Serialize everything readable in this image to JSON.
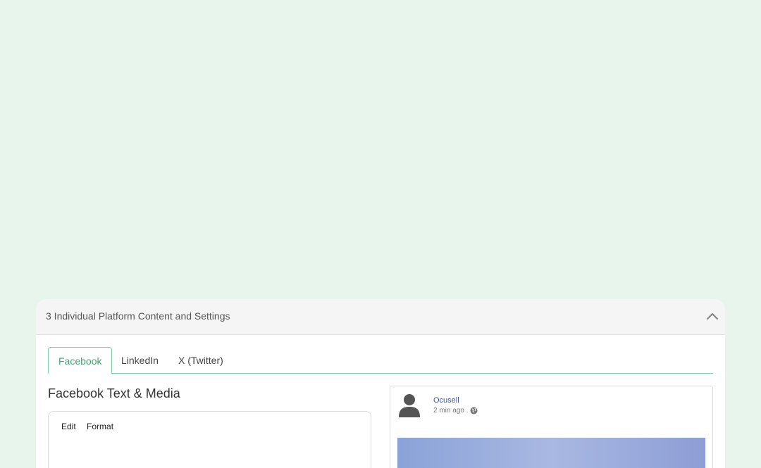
{
  "panel": {
    "title": "3 Individual Platform Content and Settings"
  },
  "tabs": [
    {
      "label": "Facebook",
      "active": true
    },
    {
      "label": "LinkedIn",
      "active": false
    },
    {
      "label": "X (Twitter)",
      "active": false
    }
  ],
  "editor_section": {
    "title": "Facebook Text & Media",
    "menu": [
      "Edit",
      "Format"
    ]
  },
  "preview": {
    "page_name": "Ocusell",
    "time": "2 min ago ."
  },
  "colors": {
    "page_bg": "#e8f5ec",
    "accent": "#3aa76d",
    "link": "#3b5998"
  }
}
